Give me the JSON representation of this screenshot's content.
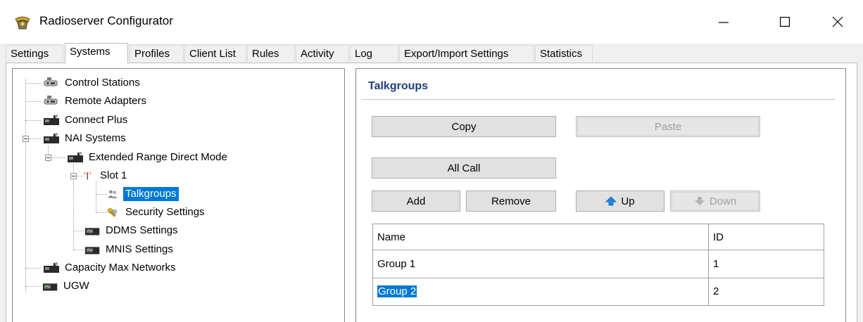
{
  "window": {
    "title": "Radioserver Configurator"
  },
  "icons": {
    "app": "app-icon",
    "minimize": "minimize-icon",
    "maximize": "maximize-icon",
    "close": "close-icon",
    "up": "up-arrow-icon",
    "down": "down-arrow-icon"
  },
  "tabs": [
    {
      "label": "Settings"
    },
    {
      "label": "Systems",
      "active": true
    },
    {
      "label": "Profiles"
    },
    {
      "label": "Client List"
    },
    {
      "label": "Rules"
    },
    {
      "label": "Activity"
    },
    {
      "label": "Log"
    },
    {
      "label": "Export/Import Settings"
    },
    {
      "label": "Statistics"
    }
  ],
  "tree": [
    {
      "label": "Control Stations",
      "icon": "control-station-icon"
    },
    {
      "label": "Remote Adapters",
      "icon": "remote-adapter-icon"
    },
    {
      "label": "Connect Plus",
      "icon": "radio-system-icon"
    },
    {
      "label": "NAI Systems",
      "icon": "radio-system-icon",
      "expanded": true
    },
    {
      "label": "Extended Range Direct Mode",
      "icon": "radio-system-icon",
      "expanded": true
    },
    {
      "label": "Slot 1",
      "icon": "antenna-icon",
      "expanded": true
    },
    {
      "label": "Talkgroups",
      "icon": "talkgroup-icon",
      "selected": true
    },
    {
      "label": "Security Settings",
      "icon": "key-icon"
    },
    {
      "label": "DDMS Settings",
      "icon": "ddms-icon"
    },
    {
      "label": "MNIS Settings",
      "icon": "mnis-icon"
    },
    {
      "label": "Capacity Max Networks",
      "icon": "radio-system-icon"
    },
    {
      "label": "UGW",
      "icon": "gateway-icon"
    }
  ],
  "panel": {
    "title": "Talkgroups",
    "buttons": {
      "copy": "Copy",
      "paste": "Paste",
      "all_call": "All Call",
      "add": "Add",
      "remove": "Remove",
      "up": "Up",
      "down": "Down"
    },
    "table": {
      "columns": [
        "Name",
        "ID"
      ],
      "rows": [
        {
          "name": "Group 1",
          "id": "1"
        },
        {
          "name": "Group 2",
          "id": "2",
          "selected": true
        }
      ]
    }
  },
  "colors": {
    "selection": "#0078d7",
    "panel_title": "#1e3f78"
  }
}
